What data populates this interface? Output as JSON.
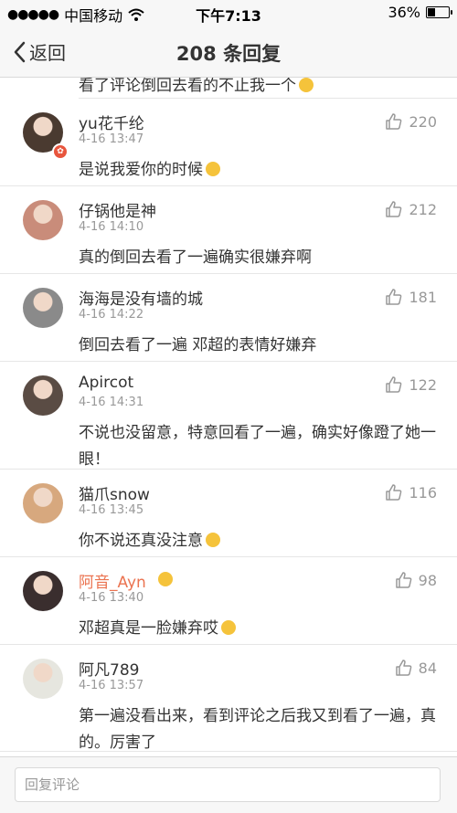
{
  "status": {
    "carrier": "中国移动",
    "time": "下午7:13",
    "battery": "36%",
    "battery_level": 0.36
  },
  "nav": {
    "back_label": "返回",
    "title": "208 条回复"
  },
  "cut_comment": "看了评论倒回去看的不止我一个",
  "comments": [
    {
      "name": "yu花千纶",
      "time": "4-16 13:47",
      "likes": "220",
      "text": "是说我爱你的时候",
      "avatar_color": "#4a3a30",
      "verified": true
    },
    {
      "name": "仔锅他是神",
      "time": "4-16 14:10",
      "likes": "212",
      "text": "真的倒回去看了一遍确实很嫌弃啊",
      "avatar_color": "#c98c7a"
    },
    {
      "name": "海海是没有墙的城",
      "time": "4-16 14:22",
      "likes": "181",
      "text": "倒回去看了一遍  邓超的表情好嫌弃",
      "avatar_color": "#8a8a8a"
    },
    {
      "name": "Apircot",
      "time": "4-16 14:31",
      "likes": "122",
      "text": "不说也没留意，特意回看了一遍，确实好像蹬了她一眼！",
      "avatar_color": "#5a4c44"
    },
    {
      "name": "猫爪snow",
      "time": "4-16 13:45",
      "likes": "116",
      "text": "你不说还真没注意",
      "avatar_color": "#d7a87e"
    },
    {
      "name": "阿音_Ayn",
      "time": "4-16 13:40",
      "likes": "98",
      "text": "邓超真是一脸嫌弃哎",
      "avatar_color": "#3a2e2e",
      "highlight": true
    },
    {
      "name": "阿凡789",
      "time": "4-16 13:57",
      "likes": "84",
      "text": "第一遍没看出来，看到评论之后我又到看了一遍，真的。厉害了",
      "avatar_color": "#e6e6df"
    }
  ],
  "reply": {
    "placeholder": "回复评论"
  }
}
